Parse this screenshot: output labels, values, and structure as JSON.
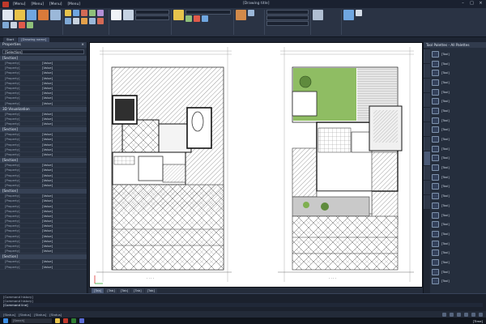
{
  "app": {
    "title": "[Drawing title]",
    "menu": [
      "[Menu]",
      "[Menu]",
      "[Menu]",
      "[Menu]"
    ]
  },
  "doc_tabs": [
    "Start",
    "[Drawing name]"
  ],
  "properties": {
    "header": "Properties",
    "selection": "[Selection]",
    "sections": [
      {
        "name": "[Section]",
        "rows": [
          [
            "[Property]",
            "[Value]"
          ],
          [
            "[Property]",
            "[Value]"
          ],
          [
            "[Property]",
            "[Value]"
          ],
          [
            "[Property]",
            "[Value]"
          ],
          [
            "[Property]",
            "[Value]"
          ],
          [
            "[Property]",
            "[Value]"
          ],
          [
            "[Property]",
            "[Value]"
          ],
          [
            "[Property]",
            "[Value]"
          ],
          [
            "[Property]",
            "[Value]"
          ]
        ]
      },
      {
        "name": "3D Visualization",
        "rows": [
          [
            "[Property]",
            "[Value]"
          ],
          [
            "[Property]",
            "[Value]"
          ],
          [
            "[Property]",
            "[Value]"
          ]
        ]
      },
      {
        "name": "[Section]",
        "rows": [
          [
            "[Property]",
            "[Value]"
          ],
          [
            "[Property]",
            "[Value]"
          ],
          [
            "[Property]",
            "[Value]"
          ],
          [
            "[Property]",
            "[Value]"
          ],
          [
            "[Property]",
            "[Value]"
          ]
        ]
      },
      {
        "name": "[Section]",
        "rows": [
          [
            "[Property]",
            "[Value]"
          ],
          [
            "[Property]",
            "[Value]"
          ],
          [
            "[Property]",
            "[Value]"
          ],
          [
            "[Property]",
            "[Value]"
          ],
          [
            "[Property]",
            "[Value]"
          ]
        ]
      },
      {
        "name": "[Section]",
        "rows": [
          [
            "[Property]",
            "[Value]"
          ],
          [
            "[Property]",
            "[Value]"
          ],
          [
            "[Property]",
            "[Value]"
          ],
          [
            "[Property]",
            "[Value]"
          ],
          [
            "[Property]",
            "[Value]"
          ],
          [
            "[Property]",
            "[Value]"
          ],
          [
            "[Property]",
            "[Value]"
          ],
          [
            "[Property]",
            "[Value]"
          ],
          [
            "[Property]",
            "[Value]"
          ],
          [
            "[Property]",
            "[Value]"
          ],
          [
            "[Property]",
            "[Value]"
          ],
          [
            "[Property]",
            "[Value]"
          ]
        ]
      },
      {
        "name": "[Section]",
        "rows": [
          [
            "[Property]",
            "[Value]"
          ],
          [
            "[Property]",
            "[Value]"
          ]
        ]
      }
    ]
  },
  "palette": {
    "header": "Tool Palettes - All Palettes",
    "items": [
      "[Tool]",
      "[Tool]",
      "[Tool]",
      "[Tool]",
      "[Tool]",
      "[Tool]",
      "[Tool]",
      "[Tool]",
      "[Tool]",
      "[Tool]",
      "[Tool]",
      "[Tool]",
      "[Tool]",
      "[Tool]",
      "[Tool]",
      "[Tool]",
      "[Tool]",
      "[Tool]",
      "[Tool]",
      "[Tool]",
      "[Tool]",
      "[Tool]",
      "[Tool]",
      "[Tool]",
      "[Tool]"
    ]
  },
  "layout_tabs": [
    "[Tab]",
    "[Tab]",
    "[Tab]",
    "[Tab]",
    "[Tab]"
  ],
  "command": {
    "history": [
      "[Command history]",
      "[Command history]"
    ],
    "input": "[Command line]"
  },
  "status": {
    "items": [
      "[Status]",
      "[Status]",
      "[Status]",
      "[Status]"
    ]
  },
  "taskbar": {
    "search": "[Search]",
    "clock": "[Time]"
  },
  "colors": {
    "accent": "#4b5a77",
    "ribbon": "#2a3344",
    "lawn": "#8fbd63",
    "hatch": "#555555"
  }
}
